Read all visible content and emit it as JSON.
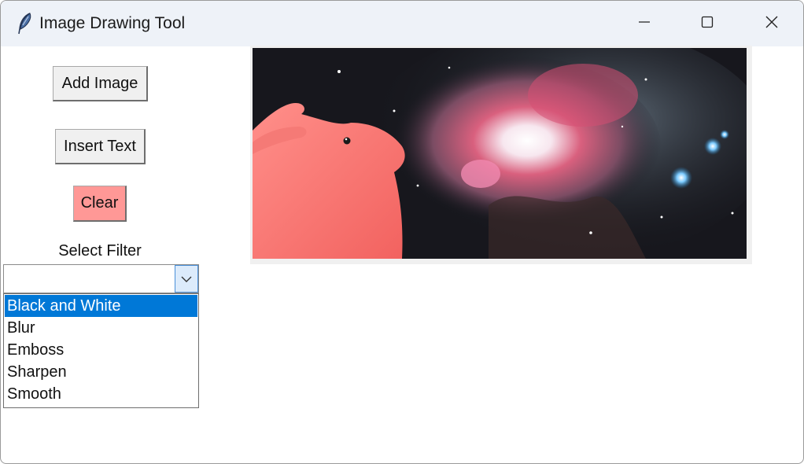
{
  "window": {
    "title": "Image Drawing Tool",
    "app_icon": "feather-icon",
    "controls": [
      "minimize-icon",
      "maximize-icon",
      "close-icon"
    ]
  },
  "toolbar": {
    "add_image_label": "Add Image",
    "insert_text_label": "Insert Text",
    "clear_label": "Clear",
    "clear_color": "#ff9896"
  },
  "filter": {
    "label": "Select Filter",
    "selected_value": "",
    "options": [
      "Black and White",
      "Blur",
      "Emboss",
      "Sharpen",
      "Smooth"
    ],
    "highlighted_option": "Black and White",
    "highlight_color": "#0078d7"
  },
  "canvas": {
    "content": "pink-rabbit-over-nebula-image"
  }
}
